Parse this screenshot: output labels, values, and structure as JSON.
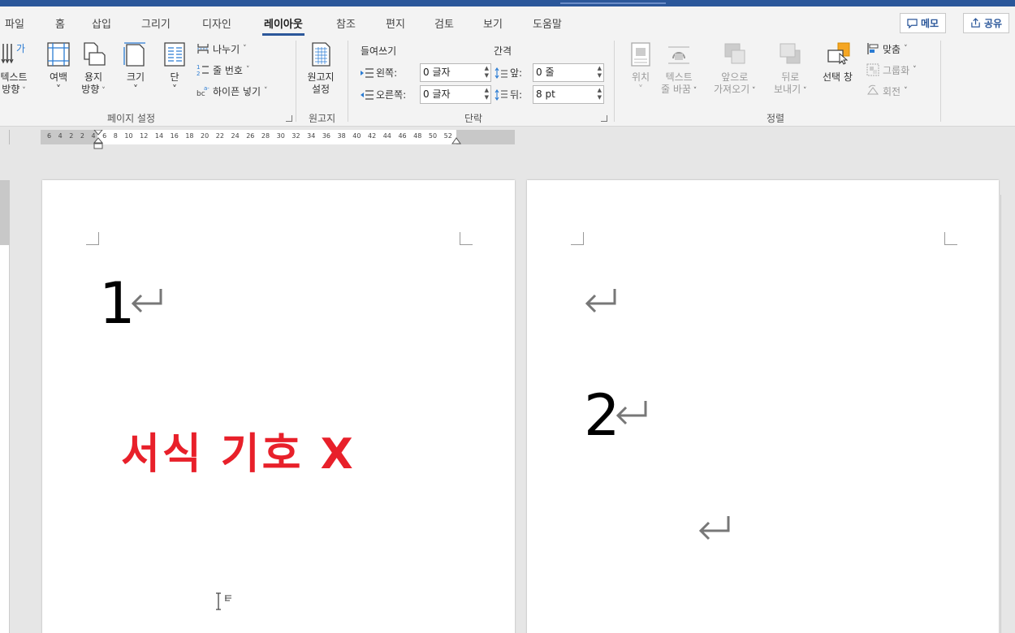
{
  "tabs": [
    "파일",
    "홈",
    "삽입",
    "그리기",
    "디자인",
    "레이아웃",
    "참조",
    "편지",
    "검토",
    "보기",
    "도움말"
  ],
  "active_tab": "레이아웃",
  "top_buttons": {
    "memo": "메모",
    "share": "공유"
  },
  "page_setup": {
    "group_label": "페이지 설정",
    "text_direction": [
      "텍스트",
      "방향"
    ],
    "margins": "여백",
    "orientation": [
      "용지",
      "방향"
    ],
    "size": "크기",
    "columns": "단",
    "breaks": "나누기",
    "line_numbers": "줄 번호",
    "hyphenation": "하이픈 넣기"
  },
  "manuscript": {
    "group_label": "원고지",
    "button": [
      "원고지",
      "설정"
    ]
  },
  "paragraph": {
    "group_label": "단락",
    "indent_label": "들여쓰기",
    "spacing_label": "간격",
    "left_label": "왼쪽:",
    "left_value": "0 글자",
    "right_label": "오른쪽:",
    "right_value": "0 글자",
    "before_label": "앞:",
    "before_value": "0 줄",
    "after_label": "뒤:",
    "after_value": "8 pt"
  },
  "arrange": {
    "group_label": "정렬",
    "position": "위치",
    "wrap_text": [
      "텍스트",
      "줄 바꿈"
    ],
    "bring_forward": [
      "앞으로",
      "가져오기"
    ],
    "send_backward": [
      "뒤로",
      "보내기"
    ],
    "selection_pane": "선택 창",
    "align": "맞춤",
    "group": "그룹화",
    "rotate": "회전"
  },
  "ruler_numbers": "6 4 2  2 4 6 8 10 12 14 16 18 20 22 24 26 28 30 32 34 36 38 40 42 44 46 48 50 52",
  "document": {
    "page1_number": "1",
    "page1_note": "서식 기호 X",
    "page2_number": "2"
  },
  "colors": {
    "accent": "#2b579a",
    "note_red": "#e8202a"
  }
}
